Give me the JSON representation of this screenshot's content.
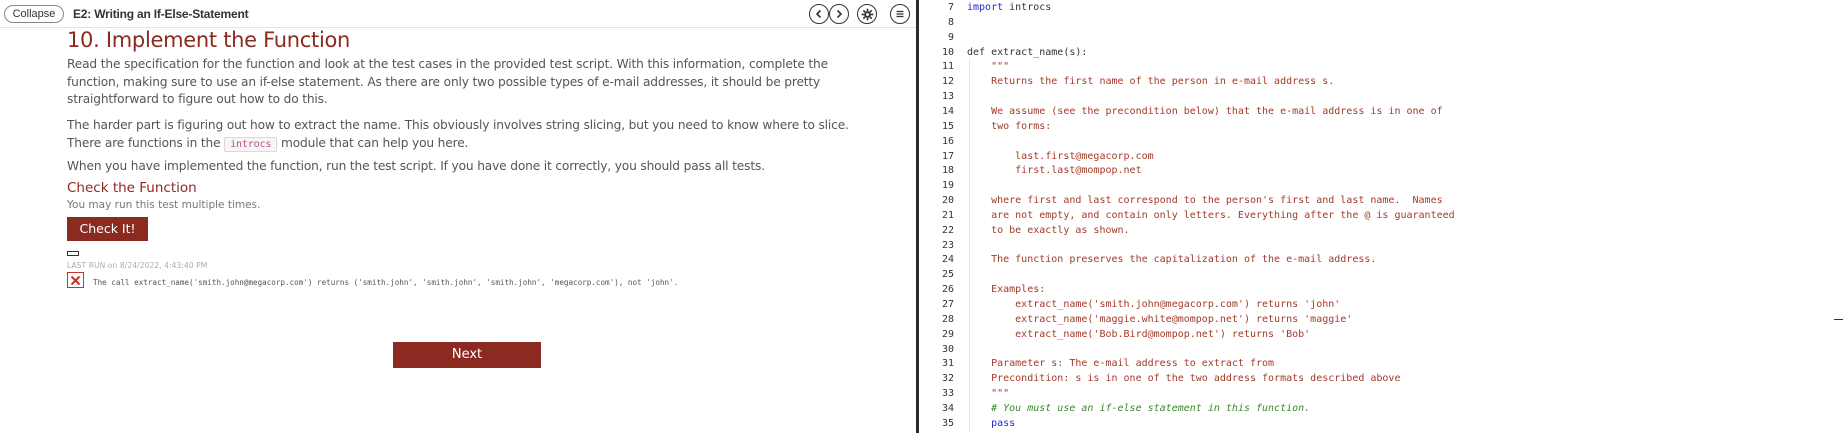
{
  "topbar": {
    "collapse_label": "Collapse",
    "lesson_title": "E2: Writing an If-Else-Statement",
    "icons": [
      "chevron-left-icon",
      "chevron-right-icon",
      "gear-icon",
      "menu-icon"
    ]
  },
  "content": {
    "heading": "10. Implement the Function",
    "p1": "Read the specification for the function and look at the test cases in the provided test script. With this information, complete the function, making sure to use an if-else statement. As there are only two possible types of e-mail addresses, it should be pretty straightforward to figure out how to do this.",
    "p2_before": "The harder part is figuring out how to extract the name. This obviously involves string slicing, but you need to know where to slice. There are functions in the ",
    "p2_code": "introcs",
    "p2_after": " module that can help you here.",
    "p3": "When you have implemented the function, run the test script. If you have done it correctly, you should pass all tests.",
    "check_title": "Check the Function",
    "check_sub": "You may run this test multiple times.",
    "check_button": "Check It!",
    "last_run": "LAST RUN on 8/24/2022, 4:43:40 PM",
    "result_message": "The call extract_name('smith.john@megacorp.com') returns ('smith.john', 'smith.john', 'smith.john', 'megacorp.com'), not 'john'.",
    "result_status": "fail",
    "next_button": "Next"
  },
  "editor": {
    "lines": [
      {
        "n": "7",
        "text": "import introcs",
        "kind": "import"
      },
      {
        "n": "8",
        "text": "",
        "kind": "plain"
      },
      {
        "n": "9",
        "text": "",
        "kind": "plain"
      },
      {
        "n": "10",
        "text": "def extract_name(s):",
        "kind": "def"
      },
      {
        "n": "11",
        "text": "    \"\"\"",
        "kind": "str"
      },
      {
        "n": "12",
        "text": "    Returns the first name of the person in e-mail address s.",
        "kind": "str"
      },
      {
        "n": "13",
        "text": "",
        "kind": "str"
      },
      {
        "n": "14",
        "text": "    We assume (see the precondition below) that the e-mail address is in one of",
        "kind": "str"
      },
      {
        "n": "15",
        "text": "    two forms:",
        "kind": "str"
      },
      {
        "n": "16",
        "text": "",
        "kind": "str"
      },
      {
        "n": "17",
        "text": "        last.first@megacorp.com",
        "kind": "str"
      },
      {
        "n": "18",
        "text": "        first.last@mompop.net",
        "kind": "str"
      },
      {
        "n": "19",
        "text": "",
        "kind": "str"
      },
      {
        "n": "20",
        "text": "    where first and last correspond to the person's first and last name.  Names",
        "kind": "str"
      },
      {
        "n": "21",
        "text": "    are not empty, and contain only letters. Everything after the @ is guaranteed",
        "kind": "str"
      },
      {
        "n": "22",
        "text": "    to be exactly as shown.",
        "kind": "str"
      },
      {
        "n": "23",
        "text": "",
        "kind": "str"
      },
      {
        "n": "24",
        "text": "    The function preserves the capitalization of the e-mail address.",
        "kind": "str"
      },
      {
        "n": "25",
        "text": "",
        "kind": "str"
      },
      {
        "n": "26",
        "text": "    Examples:",
        "kind": "str"
      },
      {
        "n": "27",
        "text": "        extract_name('smith.john@megacorp.com') returns 'john'",
        "kind": "str"
      },
      {
        "n": "28",
        "text": "        extract_name('maggie.white@mompop.net') returns 'maggie'",
        "kind": "str"
      },
      {
        "n": "29",
        "text": "        extract_name('Bob.Bird@mompop.net') returns 'Bob'",
        "kind": "str"
      },
      {
        "n": "30",
        "text": "",
        "kind": "str"
      },
      {
        "n": "31",
        "text": "    Parameter s: The e-mail address to extract from",
        "kind": "str"
      },
      {
        "n": "32",
        "text": "    Precondition: s is in one of the two address formats described above",
        "kind": "str"
      },
      {
        "n": "33",
        "text": "    \"\"\"",
        "kind": "str"
      },
      {
        "n": "34",
        "text": "    # You must use an if-else statement in this function.",
        "kind": "cmt"
      },
      {
        "n": "35",
        "text": "    pass",
        "kind": "kw"
      }
    ]
  },
  "colors": {
    "accent": "#8b2a21",
    "keyword": "#2424d6",
    "string": "#a33a2a",
    "comment": "#3a8a2a",
    "fail": "#c0342b"
  }
}
